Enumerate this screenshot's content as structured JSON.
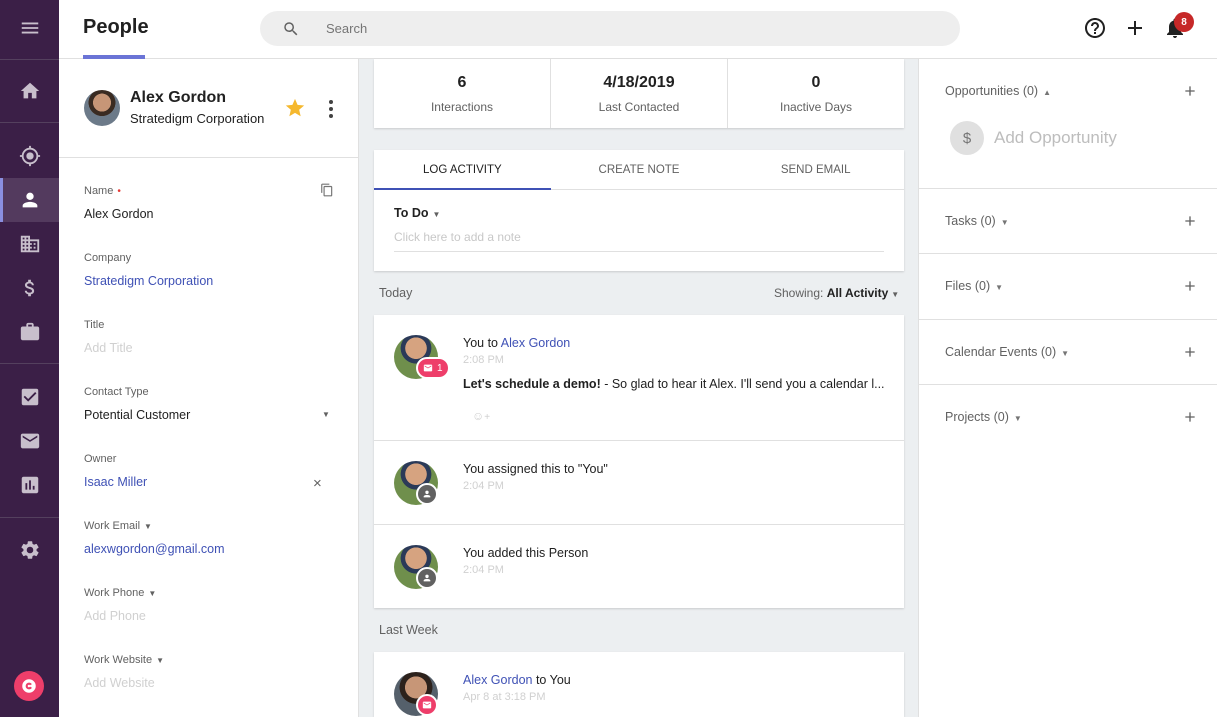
{
  "app": {
    "page_title": "People",
    "search_placeholder": "Search",
    "notification_count": "8"
  },
  "nav": {
    "items": [
      {
        "name": "menu",
        "icon": "hamburger-menu-icon"
      },
      {
        "name": "home",
        "icon": "home-icon"
      },
      {
        "name": "leads",
        "icon": "target-icon"
      },
      {
        "name": "people",
        "icon": "person-icon",
        "active": true
      },
      {
        "name": "companies",
        "icon": "building-icon"
      },
      {
        "name": "opportunities",
        "icon": "dollar-icon"
      },
      {
        "name": "projects",
        "icon": "briefcase-icon"
      },
      {
        "name": "tasks",
        "icon": "checkbox-icon"
      },
      {
        "name": "email",
        "icon": "envelope-icon"
      },
      {
        "name": "reports",
        "icon": "bar-chart-icon"
      },
      {
        "name": "settings",
        "icon": "gear-icon"
      }
    ],
    "accent_color": "#8a8fe0",
    "background_color": "#3b1f47"
  },
  "person": {
    "name": "Alex Gordon",
    "company": "Stratedigm Corporation"
  },
  "fields": {
    "name_label": "Name",
    "name_value": "Alex Gordon",
    "company_label": "Company",
    "company_value": "Stratedigm Corporation",
    "title_label": "Title",
    "title_placeholder": "Add Title",
    "contact_type_label": "Contact Type",
    "contact_type_value": "Potential Customer",
    "owner_label": "Owner",
    "owner_value": "Isaac Miller",
    "work_email_label": "Work Email",
    "work_email_value": "alexwgordon@gmail.com",
    "work_phone_label": "Work Phone",
    "work_phone_placeholder": "Add Phone",
    "work_website_label": "Work Website",
    "work_website_placeholder": "Add Website"
  },
  "stats": [
    {
      "value": "6",
      "label": "Interactions"
    },
    {
      "value": "4/18/2019",
      "label": "Last Contacted"
    },
    {
      "value": "0",
      "label": "Inactive Days"
    }
  ],
  "activity": {
    "tabs": [
      "LOG ACTIVITY",
      "CREATE NOTE",
      "SEND EMAIL"
    ],
    "active_tab": "LOG ACTIVITY",
    "type": "To Do",
    "note_placeholder": "Click here to add a note"
  },
  "feed": {
    "today_label": "Today",
    "showing_label": "Showing:",
    "showing_value": "All Activity",
    "last_week_label": "Last Week",
    "items": [
      {
        "title_prefix": "You to ",
        "title_link": "Alex Gordon",
        "time": "2:08 PM",
        "body_bold": "Let's schedule a demo!",
        "body_rest": " - So glad to hear it Alex. I'll send you a calendar l...",
        "badge_count": "1",
        "badge_icon": "envelope-icon"
      },
      {
        "title": "You assigned this to \"You\"",
        "time": "2:04 PM",
        "badge_icon": "person-icon"
      },
      {
        "title": "You added this Person",
        "time": "2:04 PM",
        "badge_icon": "person-icon"
      },
      {
        "title_link": "Alex Gordon",
        "title_suffix": " to You",
        "time": "Apr 8 at 3:18 PM",
        "badge_icon": "envelope-icon"
      }
    ]
  },
  "related": {
    "opportunities_label": "Opportunities (0)",
    "add_opportunity_label": "Add Opportunity",
    "tasks_label": "Tasks (0)",
    "files_label": "Files (0)",
    "calendar_label": "Calendar Events (0)",
    "projects_label": "Projects (0)"
  }
}
